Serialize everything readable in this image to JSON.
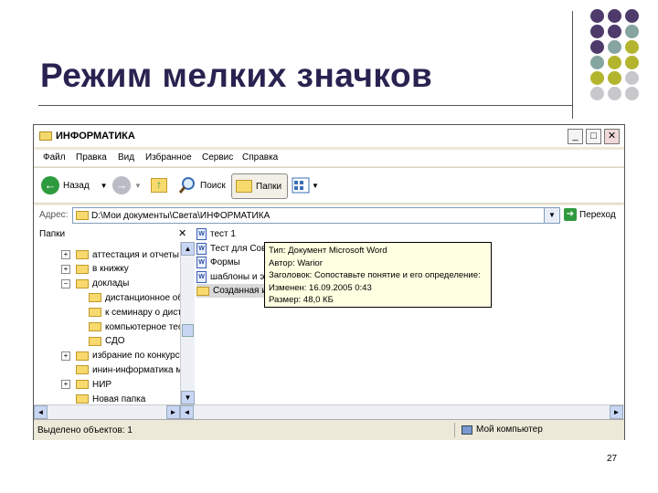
{
  "slide": {
    "title": "Режим мелких значков",
    "page_number": "27",
    "dot_colors": {
      "purple": "#4e3a6b",
      "teal": "#86a4a0",
      "olive": "#b3b52e",
      "gray": "#c8c8cc"
    }
  },
  "window": {
    "title": "ИНФОРМАТИКА",
    "min_glyph": "_",
    "max_glyph": "□",
    "close_glyph": "✕"
  },
  "menu": [
    "Файл",
    "Правка",
    "Вид",
    "Избранное",
    "Сервис",
    "Справка"
  ],
  "toolbar": {
    "back_label": "Назад",
    "search_label": "Поиск",
    "folders_label": "Папки"
  },
  "address": {
    "label": "Адрес:",
    "value": "D:\\Мои документы\\Света\\ИНФОРМАТИКА",
    "go_label": "Переход"
  },
  "folders_pane": {
    "header": "Папки",
    "close_glyph": "✕",
    "items": [
      {
        "label": "аттестация и отчеты",
        "expander": "+"
      },
      {
        "label": "в книжку",
        "expander": "+"
      },
      {
        "label": "доклады",
        "expander": "−"
      },
      {
        "label": "дистанционное об",
        "expander": ""
      },
      {
        "label": "к семинару о диста",
        "expander": ""
      },
      {
        "label": "компьютерное тес",
        "expander": ""
      },
      {
        "label": "СДО",
        "expander": ""
      },
      {
        "label": "избрание по конкурсу",
        "expander": "+"
      },
      {
        "label": "инин-информатика м",
        "expander": ""
      },
      {
        "label": "НИР",
        "expander": "+"
      },
      {
        "label": "Новая папка",
        "expander": ""
      }
    ]
  },
  "files": [
    {
      "label": "тест 1",
      "type": "doc"
    },
    {
      "label": "Тест для Сове",
      "type": "doc"
    },
    {
      "label": "Формы",
      "type": "doc"
    },
    {
      "label": "шаблоны и эл",
      "type": "doc"
    },
    {
      "label": "Созданная ин",
      "type": "folder"
    }
  ],
  "tooltip": {
    "lines": [
      "Тип: Документ Microsoft Word",
      "Автор: Warior",
      "Заголовок: Сопоставьте понятие и его определение:",
      "Изменен: 16.09.2005 0:43",
      "Размер: 48,0 КБ"
    ]
  },
  "status": {
    "left": "Выделено объектов: 1",
    "right": "Мой компьютер"
  }
}
